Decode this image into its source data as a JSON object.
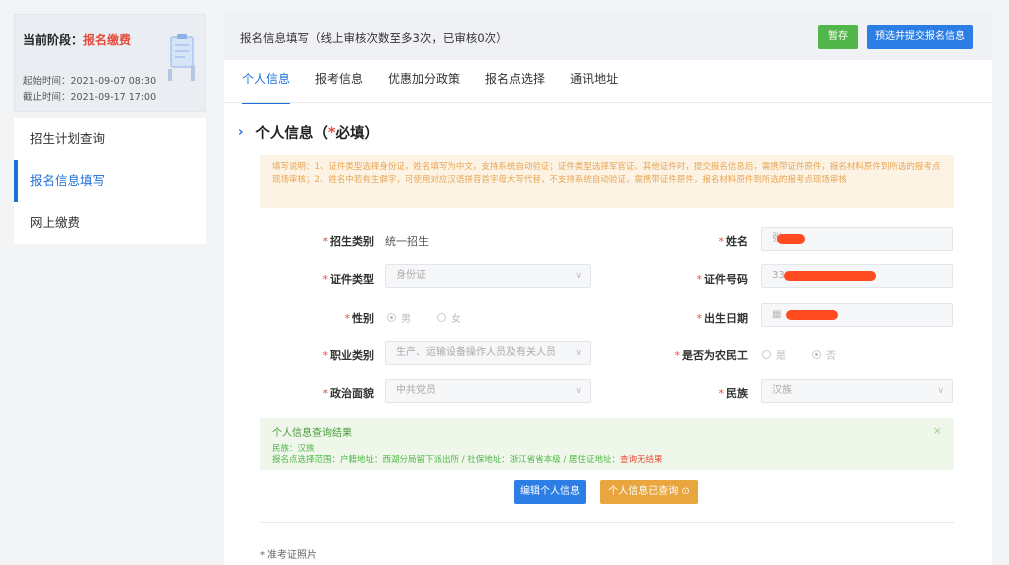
{
  "stage": {
    "label": "当前阶段：",
    "value": "报名缴费",
    "start_time": "起始时间：2021-09-07 08:30",
    "end_time": "截止时间：2021-09-17 17:00"
  },
  "sidebar": {
    "items": [
      {
        "label": "招生计划查询",
        "active": false
      },
      {
        "label": "报名信息填写",
        "active": true
      },
      {
        "label": "网上缴费",
        "active": false
      }
    ]
  },
  "topbar": {
    "title": "报名信息填写（线上审核次数至多3次，已审核0次）",
    "save_label": "暂存",
    "submit_label": "预选并提交报名信息"
  },
  "tabs": [
    {
      "label": "个人信息",
      "active": true
    },
    {
      "label": "报考信息",
      "active": false
    },
    {
      "label": "优惠加分政策",
      "active": false
    },
    {
      "label": "报名点选择",
      "active": false
    },
    {
      "label": "通讯地址",
      "active": false
    }
  ],
  "section": {
    "chev": "›",
    "title": "个人信息（",
    "star": "*",
    "title_tail": "必填）"
  },
  "notice": "填写说明：1、证件类型选择身份证，姓名填写为中文，支持系统自动验证；证件类型选择军官证、其他证件时，提交报名信息后，需携带证件原件，报名材料原件到所选的报考点现场审核；2、姓名中若有生僻字，可使用对应汉语拼音首字母大写代替，不支持系统自动验证，需携带证件原件，报名材料原件到所选的报考点现场审核",
  "form": {
    "admission_type": {
      "label": "招生类别",
      "value": "统一招生"
    },
    "name": {
      "label": "姓名",
      "value": "张"
    },
    "id_type": {
      "label": "证件类型",
      "value": "身份证"
    },
    "id_number": {
      "label": "证件号码",
      "value": "33"
    },
    "gender": {
      "label": "性别",
      "options": [
        "男",
        "女"
      ],
      "selected": "男"
    },
    "birth_date": {
      "label": "出生日期"
    },
    "occupation": {
      "label": "职业类别",
      "value": "生产、运输设备操作人员及有关人员"
    },
    "migrant_worker": {
      "label": "是否为农民工",
      "options": [
        "是",
        "否"
      ],
      "selected": "否"
    },
    "political_status": {
      "label": "政治面貌",
      "value": "中共党员"
    },
    "ethnicity": {
      "label": "民族",
      "value": "汉族"
    }
  },
  "result": {
    "title": "个人信息查询结果",
    "ethnicity_line": "民族：汉族",
    "scope_line": "报名点选择范围：户籍地址：西湖分局留下派出所 / 社保地址：浙江省省本级 / 居住证地址：",
    "scope_status": "查询无结果",
    "close": "×"
  },
  "buttons": {
    "edit_label": "编辑个人信息",
    "queried_label": "个人信息已查询 ⊙"
  },
  "photo": {
    "label": "准考证照片"
  },
  "colors": {
    "primary": "#1e6fd9",
    "green": "#52b74a",
    "orange": "#e9a63e",
    "red": "#e74c3c",
    "redact": "#ff4b1f"
  }
}
